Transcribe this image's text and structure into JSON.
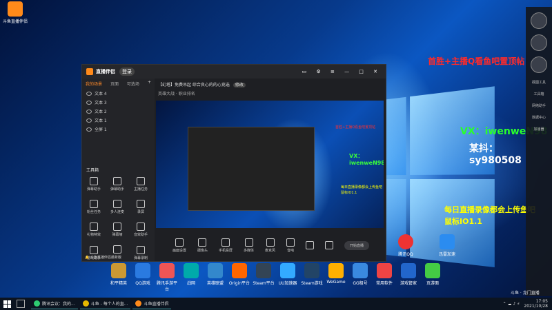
{
  "desktop_icons_left": [
    {
      "label": "斗鱼直播伴侣"
    }
  ],
  "taskbar_apps": [
    {
      "label": "和平精英"
    },
    {
      "label": "QQ游戏"
    },
    {
      "label": "腾讯手游平台"
    },
    {
      "label": "战网"
    },
    {
      "label": "英雄联盟"
    },
    {
      "label": "Origin平台"
    },
    {
      "label": "Steam平台"
    },
    {
      "label": "UU加速器"
    },
    {
      "label": "Steam游戏"
    },
    {
      "label": "WeGame"
    },
    {
      "label": "GG租号"
    },
    {
      "label": "常用软件"
    },
    {
      "label": "游戏管家"
    },
    {
      "label": "页游面"
    }
  ],
  "overlay": {
    "line1": "首胜+主播Q看鱼吧置顶帖",
    "line2": "VX：iwenweN98",
    "line3": "某抖：  sy980508",
    "line4": "每日直播录像都会上传鱼吧",
    "line5": "鼠标IO1.1"
  },
  "app": {
    "name": "直播伴侣",
    "badge": "登录",
    "stream_title": "【幻塔】免费吊起 综合良心的的心竞选",
    "title_tag": "修改",
    "category": "英雄大战 · 职业排名",
    "tabs": [
      "我的场景",
      "页面",
      "可选场"
    ],
    "sources": [
      {
        "name": "文本 4"
      },
      {
        "name": "文本 3"
      },
      {
        "name": "文本 2"
      },
      {
        "name": "文本 1"
      },
      {
        "name": "全屏 1"
      }
    ],
    "toolbox_title": "工具箱",
    "tools": [
      "弹幕助手",
      "弹幕助手",
      "主播任务",
      "粉丝任务",
      "多人连麦",
      "录屏",
      "礼物特效",
      "弹幕墙",
      "音效助手",
      "游戏助手",
      "",
      "弹幕录制"
    ],
    "notice": "斗鱼直播伴侣最新版",
    "bottom": [
      "画面设置",
      "摄像头",
      "手机投屏",
      "多媒体",
      "麦克风",
      "音响",
      "",
      "",
      "开始直播"
    ],
    "preview_overlay_1": "首胜+主播Q看鱼吧置顶帖",
    "preview_overlay_2": "VX：iwenweN98",
    "preview_overlay_3": "每日直播录像都会上传鱼吧",
    "preview_overlay_4": "鼠标IO1.1"
  },
  "right_desktop_icons": [
    {
      "label": "腾讯QQ"
    },
    {
      "label": "迅雷加速"
    }
  ],
  "side_panel": {
    "items": [
      "",
      "",
      "",
      "",
      "",
      "",
      ""
    ],
    "labels": [
      "截图工具",
      "工具箱",
      "网络助手",
      "数据中心",
      "加速器"
    ]
  },
  "taskbar": {
    "items": [
      {
        "label": "腾讯会议：我的..."
      },
      {
        "label": "斗鱼 - 每个人的直..."
      },
      {
        "label": "斗鱼直播伴侣"
      }
    ],
    "clock": "17:05",
    "date": "2021/10/28"
  },
  "watermark": "斗鱼 · 龙门直播"
}
